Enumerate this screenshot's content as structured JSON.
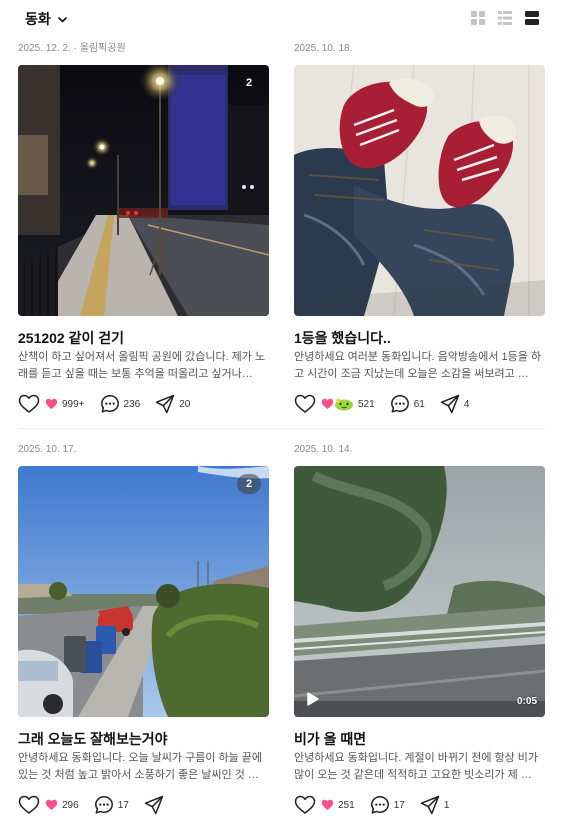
{
  "filter": {
    "label": "동화"
  },
  "view_toggle": {
    "icons": [
      "grid-icon",
      "list-compact-icon",
      "feed-icon"
    ],
    "active": "feed-icon"
  },
  "colors": {
    "heart_pink": "#ff4f8b",
    "reaction_green": "#9ed640",
    "text_muted": "#8a8a8a"
  },
  "posts": [
    {
      "meta": "2025. 12. 2. · 올림픽공원",
      "badge": "2",
      "title": "251202 같이 걷기",
      "excerpt": "산책이 하고 싶어져서 올림픽 공원에 갔습니다. 제가 노래를 듣고 싶을 때는 보통 추억을 떠올리고 싶거나…",
      "likes": "999+",
      "comments": "236",
      "shares": "20"
    },
    {
      "meta": "2025. 10. 18.",
      "badge": "",
      "title": "1등을 했습니다..",
      "excerpt": "안녕하세요 여러분 동화입니다. 음악방송에서 1등을 하고 시간이 조금 지났는데 오늘은 소감을 써보려고 …",
      "likes": "521",
      "comments": "61",
      "shares": "4"
    },
    {
      "meta": "2025. 10. 17.",
      "badge": "2",
      "title": "그래 오늘도 잘해보는거야",
      "excerpt": "안녕하세요 동화입니다. 오늘 날씨가 구름이 하늘 끝에 있는 것 처럼 높고 밝아서 소풍하기 좋은 날씨인 것 …",
      "likes": "296",
      "comments": "17",
      "shares": ""
    },
    {
      "meta": "2025. 10. 14.",
      "badge": "",
      "duration": "0:05",
      "title": "비가 올 때면",
      "excerpt": "안녕하세요 동화입니다. 계절이 바뀌기 전에 항상 비가 많이 오는 것 같은데 적적하고 고요한 빗소리가 제 …",
      "likes": "251",
      "comments": "17",
      "shares": "1"
    }
  ]
}
